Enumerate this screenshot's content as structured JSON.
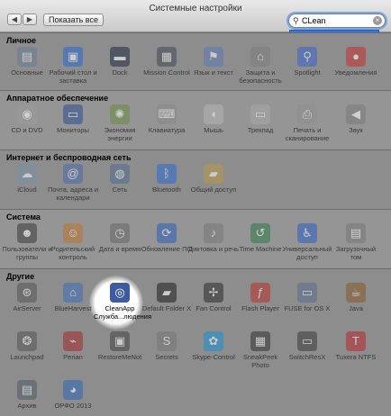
{
  "window": {
    "title": "Системные настройки"
  },
  "toolbar": {
    "back_icon": "chevron-left-icon",
    "forward_icon": "chevron-right-icon",
    "show_all_label": "Показать все"
  },
  "search": {
    "value": "CLean",
    "suggestion": "CleanApp"
  },
  "colors": {
    "accent": "#3875d7",
    "panel": "#8d8d8d",
    "highlight": "#ffffff"
  },
  "sections": [
    {
      "title": "Личное",
      "items": [
        {
          "label": "Основные",
          "icon": "general-icon",
          "glyph": "▤",
          "color": "#6c7c94",
          "dim": true
        },
        {
          "label": "Рабочий стол и заставка",
          "icon": "desktop-icon",
          "glyph": "▣",
          "color": "#2a6ad0",
          "dim": true
        },
        {
          "label": "Dock",
          "icon": "dock-icon",
          "glyph": "▬",
          "color": "#1f2b3d",
          "dim": true
        },
        {
          "label": "Mission Control",
          "icon": "mission-control-icon",
          "glyph": "▦",
          "color": "#404854",
          "dim": true
        },
        {
          "label": "Язык и текст",
          "icon": "flag-icon",
          "glyph": "⚑",
          "color": "#5c7ab6",
          "dim": true
        },
        {
          "label": "Защита и безопасность",
          "icon": "house-lock-icon",
          "glyph": "⌂",
          "color": "#7d7d7d",
          "dim": true
        },
        {
          "label": "Spotlight",
          "icon": "spotlight-icon",
          "glyph": "⚲",
          "color": "#3b66c9",
          "dim": true
        },
        {
          "label": "Уведомления",
          "icon": "notifications-icon",
          "glyph": "●",
          "color": "#c4322f",
          "dim": true
        }
      ]
    },
    {
      "title": "Аппаратное обеспечение",
      "items": [
        {
          "label": "CD и DVD",
          "icon": "disc-icon",
          "glyph": "◉",
          "color": "#9b9b9b",
          "dim": true
        },
        {
          "label": "Мониторы",
          "icon": "monitor-icon",
          "glyph": "▭",
          "color": "#2d4f8e",
          "dim": true
        },
        {
          "label": "Экономия энергии",
          "icon": "bulb-icon",
          "glyph": "✺",
          "color": "#6a8c3f",
          "dim": true
        },
        {
          "label": "Клавиатура",
          "icon": "keyboard-icon",
          "glyph": "⌨",
          "color": "#8a8a8a",
          "dim": true
        },
        {
          "label": "Мышь",
          "icon": "mouse-icon",
          "glyph": "◖",
          "color": "#b5b5b5",
          "dim": true
        },
        {
          "label": "Трекпад",
          "icon": "trackpad-icon",
          "glyph": "▭",
          "color": "#a8a8a8",
          "dim": true
        },
        {
          "label": "Печать и сканирование",
          "icon": "printer-icon",
          "glyph": "⎙",
          "color": "#8f8f8f",
          "dim": true
        },
        {
          "label": "Звук",
          "icon": "speaker-icon",
          "glyph": "◀",
          "color": "#7a7a7a",
          "dim": true
        }
      ]
    },
    {
      "title": "Интернет и беспроводная сеть",
      "items": [
        {
          "label": "iCloud",
          "icon": "cloud-icon",
          "glyph": "☁",
          "color": "#7b8faa",
          "dim": true
        },
        {
          "label": "Почта, адреса и календари",
          "icon": "at-icon",
          "glyph": "@",
          "color": "#4a6aa8",
          "dim": true
        },
        {
          "label": "Сеть",
          "icon": "network-globe-icon",
          "glyph": "◍",
          "color": "#516b8c",
          "dim": true
        },
        {
          "label": "Bluetooth",
          "icon": "bluetooth-icon",
          "glyph": "ᛒ",
          "color": "#2f6ad1",
          "dim": true
        },
        {
          "label": "Общий доступ",
          "icon": "sharing-folder-icon",
          "glyph": "▰",
          "color": "#b89a45",
          "dim": true
        }
      ]
    },
    {
      "title": "Система",
      "items": [
        {
          "label": "Пользователи и группы",
          "icon": "users-icon",
          "glyph": "☻",
          "color": "#3b3b3b",
          "dim": true
        },
        {
          "label": "Родительский контроль",
          "icon": "parental-icon",
          "glyph": "☺",
          "color": "#b9762c",
          "dim": true
        },
        {
          "label": "Дата и время",
          "icon": "clock-icon",
          "glyph": "◷",
          "color": "#666",
          "dim": true
        },
        {
          "label": "Обновление ПО",
          "icon": "update-icon",
          "glyph": "⟳",
          "color": "#2d5fb8",
          "dim": true
        },
        {
          "label": "Диктовка и речь",
          "icon": "microphone-icon",
          "glyph": "♪",
          "color": "#777",
          "dim": true
        },
        {
          "label": "Time Machine",
          "icon": "time-machine-icon",
          "glyph": "↺",
          "color": "#2d7a4a",
          "dim": true
        },
        {
          "label": "Универсальный доступ",
          "icon": "accessibility-icon",
          "glyph": "♿",
          "color": "#2f5fc4",
          "dim": true
        },
        {
          "label": "Загрузочный том",
          "icon": "startup-disk-icon",
          "glyph": "▤",
          "color": "#777",
          "dim": true
        }
      ]
    },
    {
      "title": "Другие",
      "items": [
        {
          "label": "AirServer",
          "icon": "airserver-icon",
          "glyph": "⊛",
          "color": "#555",
          "dim": true
        },
        {
          "label": "BlueHarvest",
          "icon": "blueharvest-icon",
          "glyph": "⌂",
          "color": "#3e6fb5",
          "dim": true
        },
        {
          "label": "CleanApp Служба...людения",
          "icon": "cleanapp-icon",
          "glyph": "◎",
          "color": "#3d5b9e",
          "dim": false
        },
        {
          "label": "Default Folder X",
          "icon": "default-folder-icon",
          "glyph": "▰",
          "color": "#1f1f1f",
          "dim": true
        },
        {
          "label": "Fan Control",
          "icon": "fan-icon",
          "glyph": "✢",
          "color": "#2b2b2b",
          "dim": true
        },
        {
          "label": "Flash Player",
          "icon": "flash-icon",
          "glyph": "ƒ",
          "color": "#b8322c",
          "dim": true
        },
        {
          "label": "FUSE for OS X",
          "icon": "fuse-icon",
          "glyph": "▭",
          "color": "#5a6e92",
          "dim": true
        },
        {
          "label": "Java",
          "icon": "java-icon",
          "glyph": "☕",
          "color": "#8a5a2a",
          "dim": true
        },
        {
          "label": "Launchpad",
          "icon": "launchpad-icon",
          "glyph": "❂",
          "color": "#555",
          "dim": true
        },
        {
          "label": "Perian",
          "icon": "perian-icon",
          "glyph": "⌁",
          "color": "#a52a2a",
          "dim": true
        },
        {
          "label": "RestoreMeNot",
          "icon": "restoremenot-icon",
          "glyph": "▣",
          "color": "#444",
          "dim": true
        },
        {
          "label": "Secrets",
          "icon": "secrets-icon",
          "glyph": "S",
          "color": "#777",
          "dim": true
        },
        {
          "label": "Skype-Control",
          "icon": "skype-control-icon",
          "glyph": "✿",
          "color": "#1a8fd1",
          "dim": true
        },
        {
          "label": "SneakPeek Photo",
          "icon": "sneakpeek-icon",
          "glyph": "▦",
          "color": "#333",
          "dim": true
        },
        {
          "label": "SwitchResX",
          "icon": "switchresx-icon",
          "glyph": "▭",
          "color": "#3a3a3a",
          "dim": true
        },
        {
          "label": "Tuxera NTFS",
          "icon": "tuxera-icon",
          "glyph": "T",
          "color": "#b7282e",
          "dim": true
        },
        {
          "label": "Архив",
          "icon": "archive-icon",
          "glyph": "▤",
          "color": "#4f5b66",
          "dim": true
        },
        {
          "label": "ОРФО 2013",
          "icon": "orfo-icon",
          "glyph": "◕",
          "color": "#2e66b4",
          "dim": true
        }
      ]
    }
  ]
}
